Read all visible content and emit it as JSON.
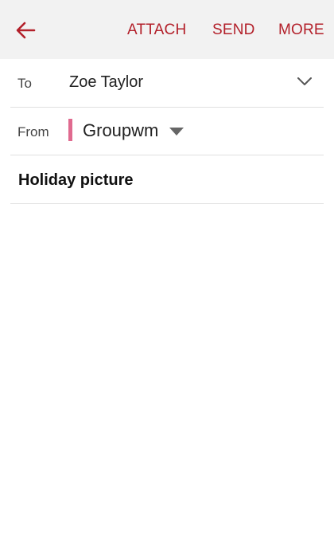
{
  "toolbar": {
    "back_icon": "arrow-left-icon",
    "actions": {
      "attach": "ATTACH",
      "send": "SEND",
      "more": "MORE"
    },
    "accent_color": "#b3202a"
  },
  "to": {
    "label": "To",
    "value": "Zoe Taylor",
    "expand_icon": "chevron-down-icon"
  },
  "from": {
    "label": "From",
    "value": "Groupwm",
    "account_color": "#e06a8f",
    "dropdown_icon": "caret-down-icon"
  },
  "subject": {
    "value": "Holiday picture"
  },
  "body": {
    "value": ""
  }
}
